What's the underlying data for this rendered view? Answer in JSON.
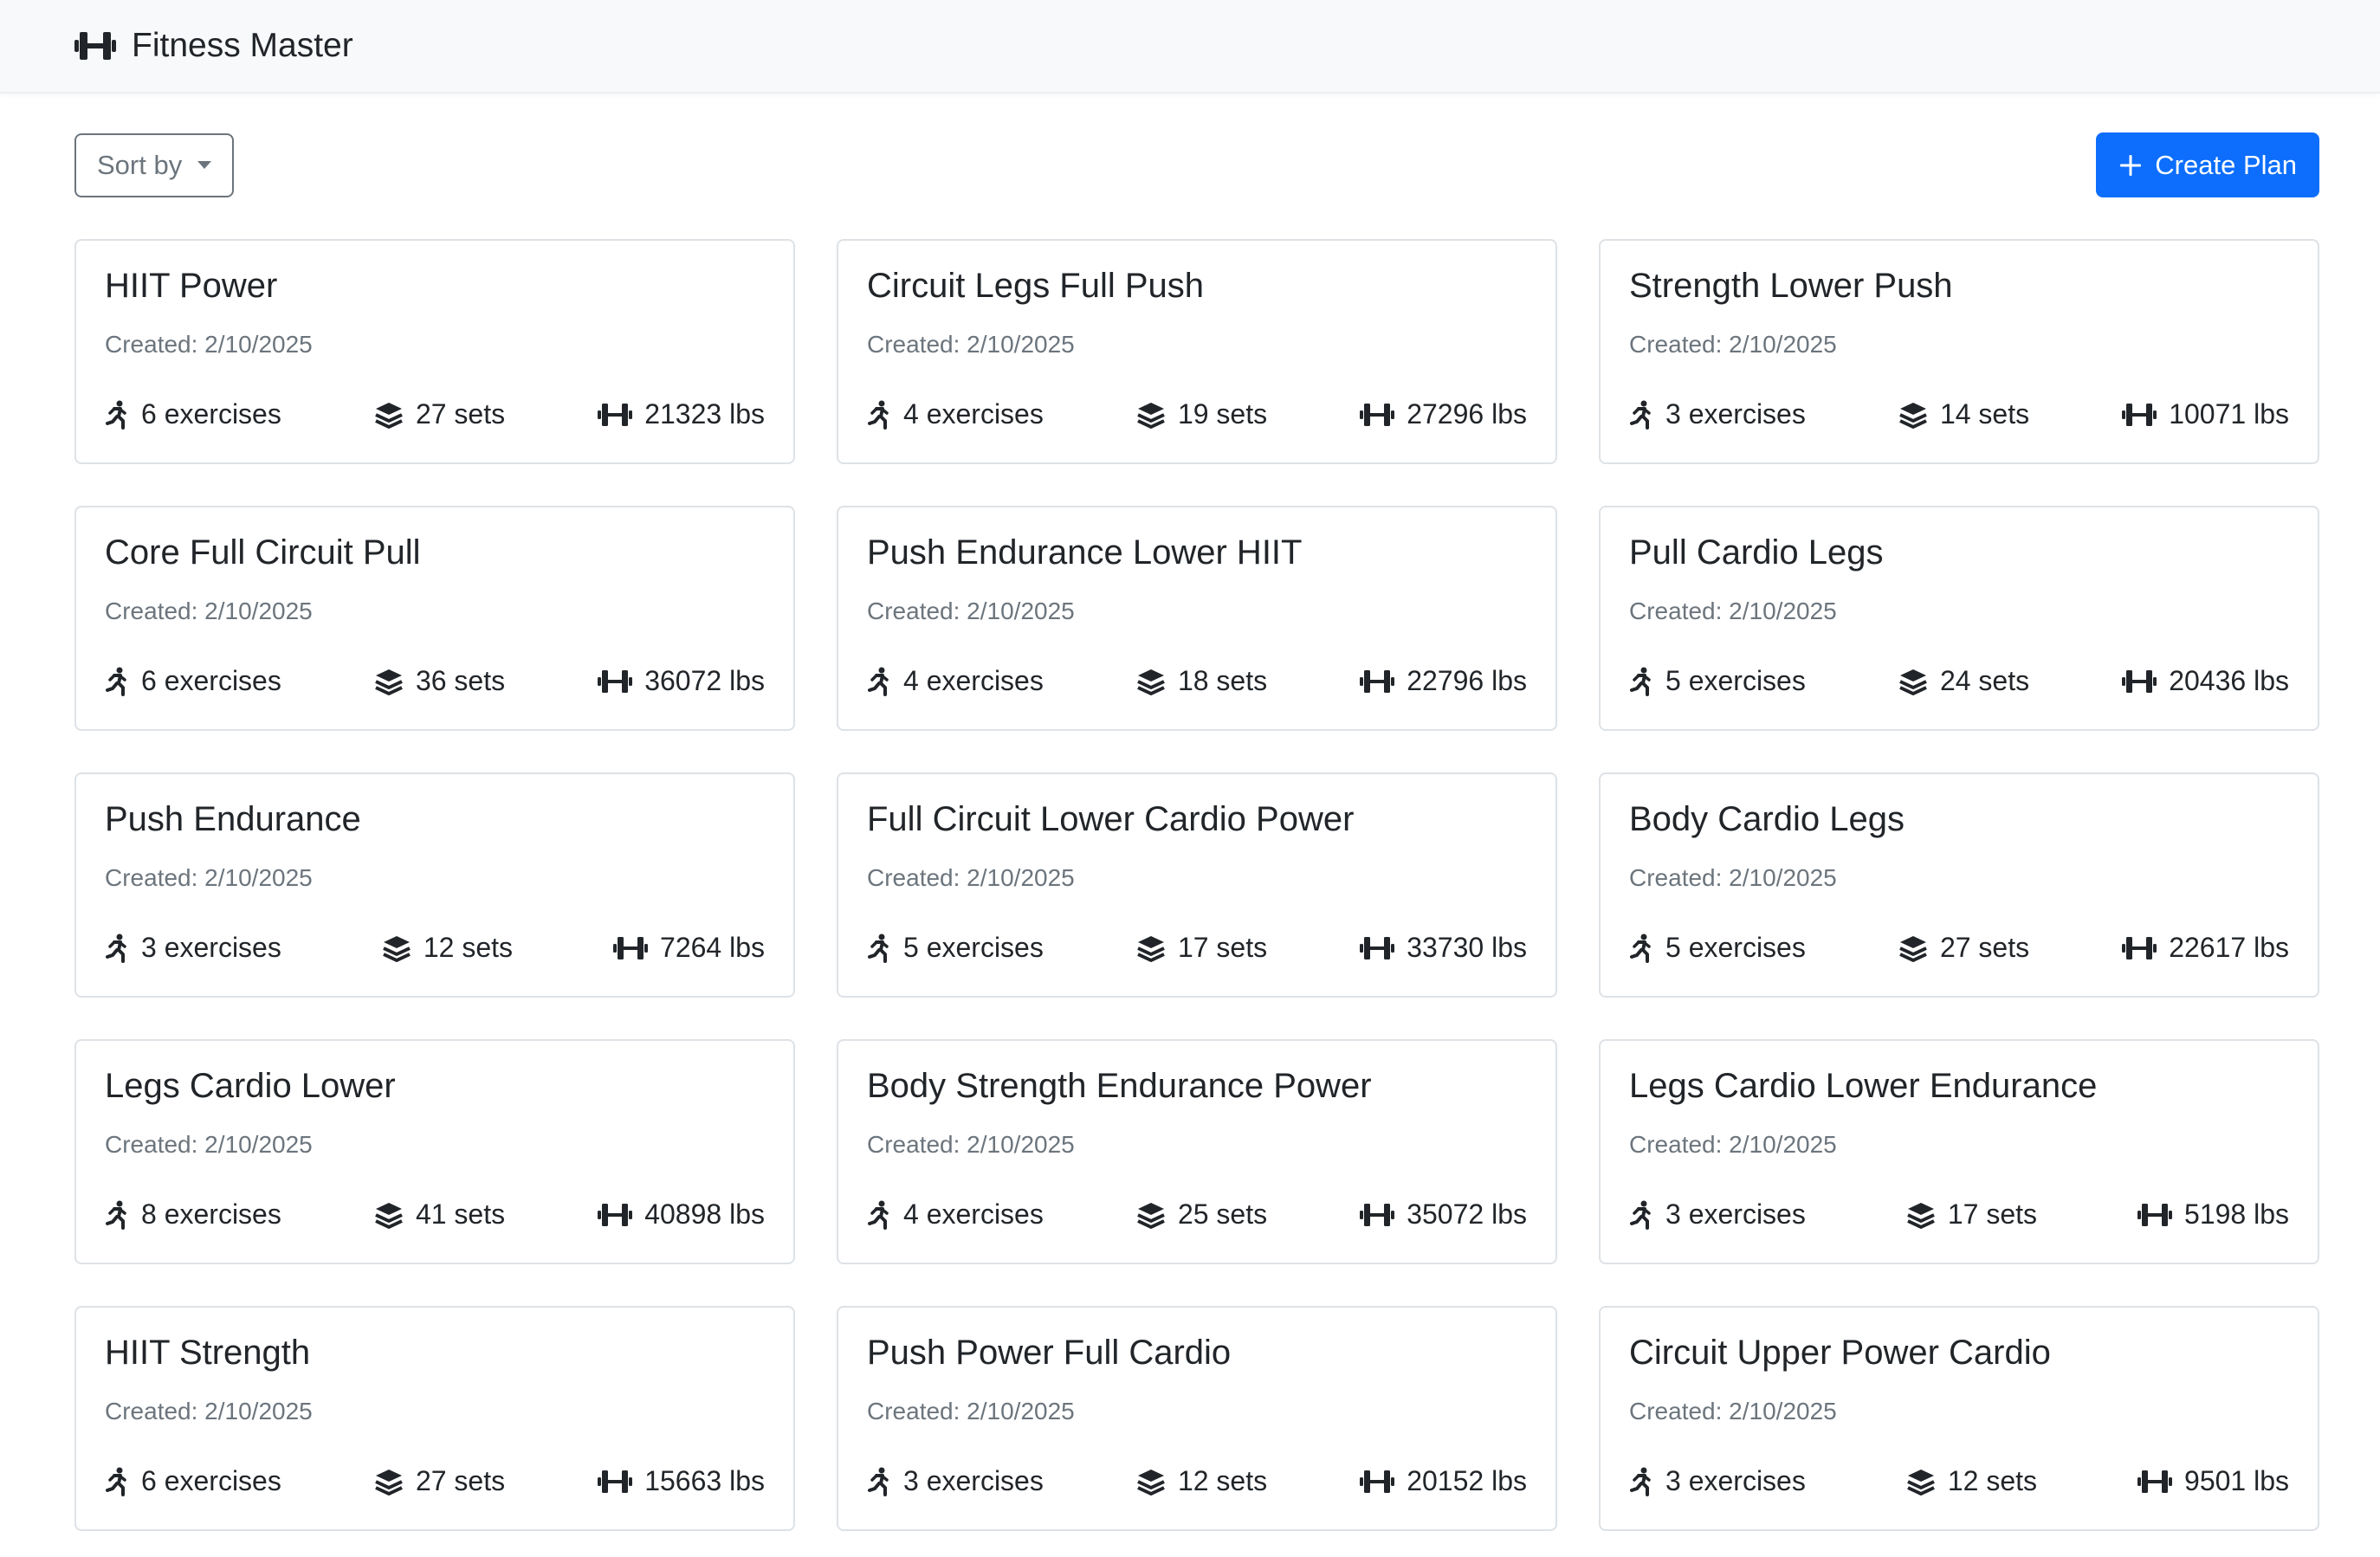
{
  "app": {
    "title": "Fitness Master",
    "brand_icon": "dumbbell-icon"
  },
  "toolbar": {
    "sort_label": "Sort by",
    "create_label": "Create Plan"
  },
  "colors": {
    "primary": "#0d6efd",
    "muted": "#6c757d",
    "border": "#dee2e6",
    "navbar_bg": "#f8f9fa"
  },
  "plans": [
    {
      "title": "HIIT Power",
      "created": "Created: 2/10/2025",
      "exercises": "6 exercises",
      "sets": "27 sets",
      "weight": "21323 lbs"
    },
    {
      "title": "Circuit Legs Full Push",
      "created": "Created: 2/10/2025",
      "exercises": "4 exercises",
      "sets": "19 sets",
      "weight": "27296 lbs"
    },
    {
      "title": "Strength Lower Push",
      "created": "Created: 2/10/2025",
      "exercises": "3 exercises",
      "sets": "14 sets",
      "weight": "10071 lbs"
    },
    {
      "title": "Core Full Circuit Pull",
      "created": "Created: 2/10/2025",
      "exercises": "6 exercises",
      "sets": "36 sets",
      "weight": "36072 lbs"
    },
    {
      "title": "Push Endurance Lower HIIT",
      "created": "Created: 2/10/2025",
      "exercises": "4 exercises",
      "sets": "18 sets",
      "weight": "22796 lbs"
    },
    {
      "title": "Pull Cardio Legs",
      "created": "Created: 2/10/2025",
      "exercises": "5 exercises",
      "sets": "24 sets",
      "weight": "20436 lbs"
    },
    {
      "title": "Push Endurance",
      "created": "Created: 2/10/2025",
      "exercises": "3 exercises",
      "sets": "12 sets",
      "weight": "7264 lbs"
    },
    {
      "title": "Full Circuit Lower Cardio Power",
      "created": "Created: 2/10/2025",
      "exercises": "5 exercises",
      "sets": "17 sets",
      "weight": "33730 lbs"
    },
    {
      "title": "Body Cardio Legs",
      "created": "Created: 2/10/2025",
      "exercises": "5 exercises",
      "sets": "27 sets",
      "weight": "22617 lbs"
    },
    {
      "title": "Legs Cardio Lower",
      "created": "Created: 2/10/2025",
      "exercises": "8 exercises",
      "sets": "41 sets",
      "weight": "40898 lbs"
    },
    {
      "title": "Body Strength Endurance Power",
      "created": "Created: 2/10/2025",
      "exercises": "4 exercises",
      "sets": "25 sets",
      "weight": "35072 lbs"
    },
    {
      "title": "Legs Cardio Lower Endurance",
      "created": "Created: 2/10/2025",
      "exercises": "3 exercises",
      "sets": "17 sets",
      "weight": "5198 lbs"
    },
    {
      "title": "HIIT Strength",
      "created": "Created: 2/10/2025",
      "exercises": "6 exercises",
      "sets": "27 sets",
      "weight": "15663 lbs"
    },
    {
      "title": "Push Power Full Cardio",
      "created": "Created: 2/10/2025",
      "exercises": "3 exercises",
      "sets": "12 sets",
      "weight": "20152 lbs"
    },
    {
      "title": "Circuit Upper Power Cardio",
      "created": "Created: 2/10/2025",
      "exercises": "3 exercises",
      "sets": "12 sets",
      "weight": "9501 lbs"
    }
  ]
}
